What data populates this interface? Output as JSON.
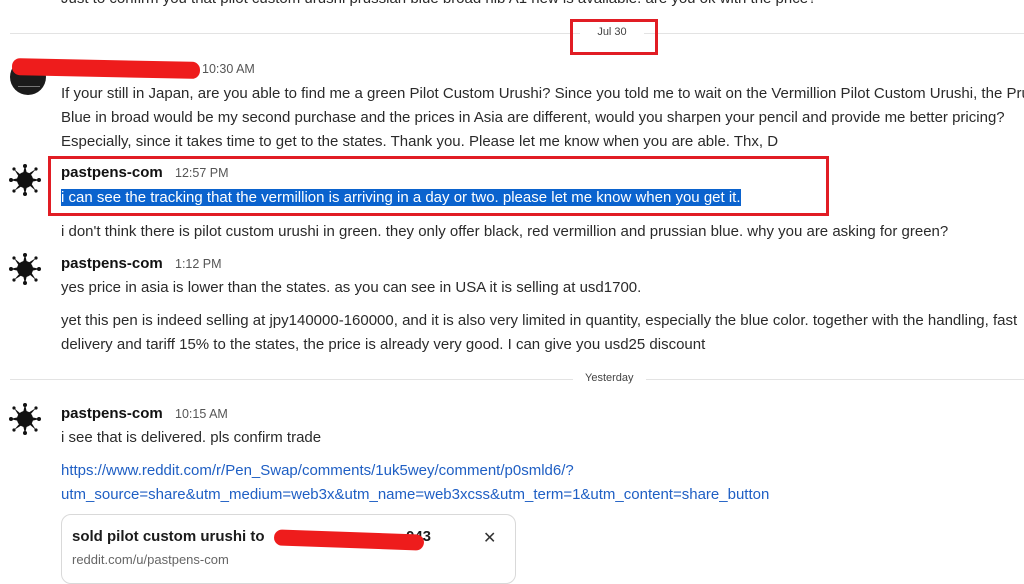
{
  "top_partial_text": "Just to confirm you that pilot custom urushi prussian blue broad nib A1 new is available. are you ok with the price?",
  "dividers": {
    "jul30": "Jul 30",
    "yesterday": "Yesterday"
  },
  "msg1": {
    "time": "10:30 AM",
    "lines": [
      "If your still in Japan, are you able to find me a green Pilot Custom Urushi? Since you told me to wait on the Vermillion Pilot Custom Urushi, the Prussian",
      "Blue in broad would be my second purchase and the prices in Asia are different, would you sharpen your pencil and provide me better pricing?",
      "Especially, since it takes time to get to the states. Thank you. Please let me know when you are able. Thx, D"
    ]
  },
  "msg2": {
    "user": "pastpens-com",
    "time": "12:57 PM",
    "line1": "i can see the tracking that the vermillion is arriving in a day or two. please let me know when you get it.",
    "line2": "i don't think there is pilot custom urushi in green. they only offer black, red vermillion and prussian blue. why you are asking for green?"
  },
  "msg3": {
    "user": "pastpens-com",
    "time": "1:12 PM",
    "line1": "yes price in asia is lower than the states. as you can see in USA it is selling at usd1700.",
    "line2": "yet this pen is indeed selling at jpy140000-160000, and it is also very limited in quantity, especially the blue color. together with the handling, fast",
    "line3": "delivery and tariff 15% to the states, the price is already very good. I can give you usd25 discount"
  },
  "msg4": {
    "user": "pastpens-com",
    "time": "10:15 AM",
    "line1": "i see that is delivered. pls confirm trade",
    "link_line1": "https://www.reddit.com/r/Pen_Swap/comments/1uk5wey/comment/p0smld6/?",
    "link_line2": "utm_source=share&utm_medium=web3x&utm_name=web3xcss&utm_term=1&utm_content=share_button"
  },
  "preview": {
    "title": "sold pilot custom urushi to",
    "title_tail": "043",
    "url": "reddit.com/u/pastpens-com",
    "close_glyph": "✕"
  },
  "colors": {
    "annotation_red": "#e11d24",
    "selection_blue": "#0b63ce",
    "link_blue": "#1f5fc4"
  }
}
